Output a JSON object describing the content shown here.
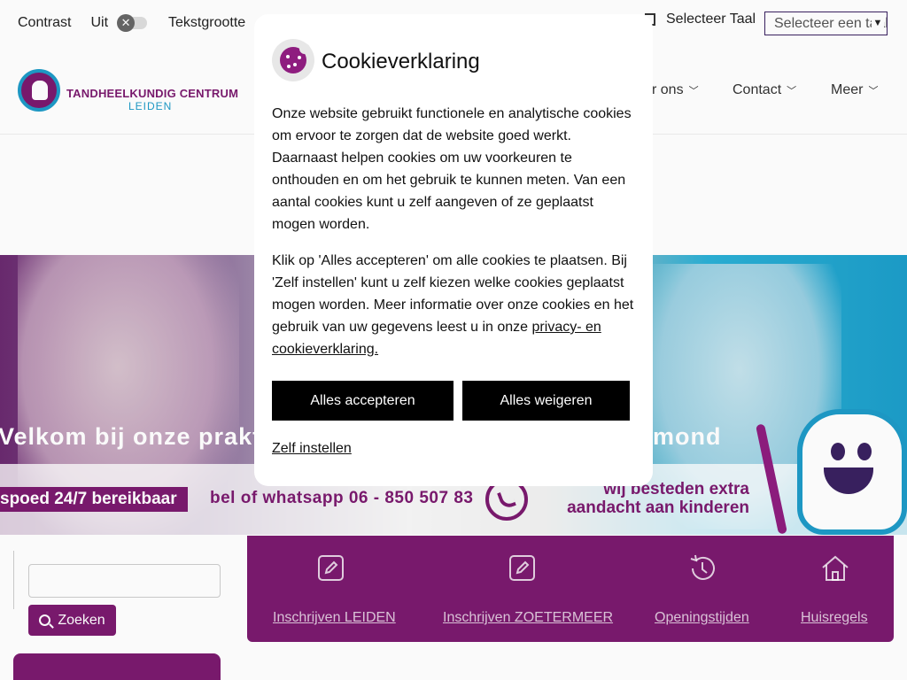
{
  "accessibility": {
    "contrast_label": "Contrast",
    "contrast_state": "Uit",
    "toggle_glyph": "✕",
    "textsize_label": "Tekstgrootte",
    "textsize_dash": "–"
  },
  "language": {
    "label": "Selecteer Taal",
    "select_value": "Selecteer een taal"
  },
  "logo": {
    "name": "TANDHEELKUNDIG CENTRUM",
    "city": "LEIDEN"
  },
  "nav": {
    "items": [
      {
        "label": "r ons"
      },
      {
        "label": "Contact"
      },
      {
        "label": "Meer"
      }
    ],
    "chevron": "⌵"
  },
  "hero": {
    "welcome_left": "Velkom bij onze prakti",
    "welcome_right": "mond",
    "spoed": "spoed 24/7 bereikbaar",
    "phone": "bel of whatsapp  06 - 850 507 83",
    "kids_line1": "wij besteden extra",
    "kids_line2": "aandacht aan kinderen"
  },
  "search": {
    "value": "",
    "button_label": "Zoeken"
  },
  "quicklinks": [
    {
      "label": "Inschrijven LEIDEN",
      "icon": "edit-icon"
    },
    {
      "label": "Inschrijven ZOETERMEER",
      "icon": "edit-icon"
    },
    {
      "label": "Openingstijden",
      "icon": "history-icon"
    },
    {
      "label": "Huisregels",
      "icon": "home-icon"
    }
  ],
  "cookie_modal": {
    "title": "Cookieverklaring",
    "paragraph1": "Onze website gebruikt functionele en analytische cookies om ervoor te zorgen dat de website goed werkt. Daarnaast helpen cookies om uw voorkeuren te onthouden en om het gebruik te kunnen meten. Van een aantal cookies kunt u zelf aangeven of ze geplaatst mogen worden.",
    "paragraph2": "Klik op 'Alles accepteren' om alle cookies te plaatsen. Bij 'Zelf instellen' kunt u zelf kiezen welke cookies geplaatst mogen worden. Meer informatie over onze cookies en het gebruik van uw gegevens leest u in onze ",
    "privacy_link": "privacy- en cookieverklaring.",
    "accept_label": "Alles accepteren",
    "reject_label": "Alles weigeren",
    "settings_label": "Zelf instellen"
  },
  "colors": {
    "brand_purple": "#7b1a6f",
    "brand_blue": "#1e9bc7",
    "button_black": "#000000"
  }
}
